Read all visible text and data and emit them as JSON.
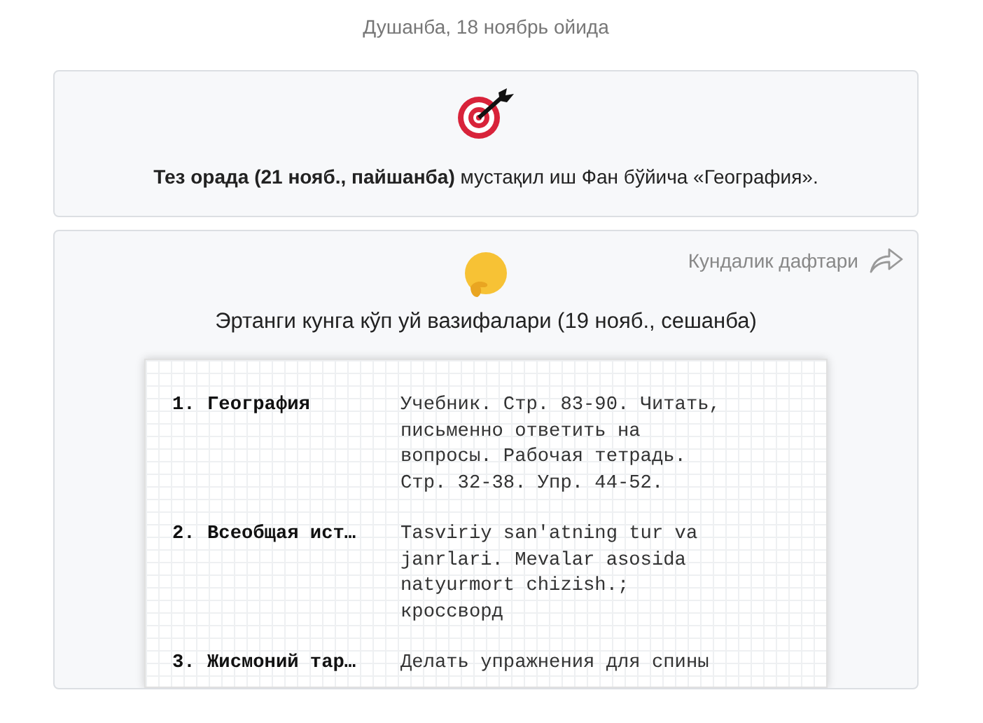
{
  "date_header": "Душанба, 18 ноябрь ойида",
  "deadline_card": {
    "text": "**Тез орада (21 нояб., пайшанба)** мустақил иш Фан бўйича «География»."
  },
  "homework_card": {
    "link": "Кундалик дафтари",
    "title": "Эртанги кунга кўп уй вазифалари (19 нояб., сешанба)",
    "items": [
      {
        "number": "1.",
        "subject": "География",
        "task": "Учебник. Стр. 83-90. Читать, письменно ответить на вопросы. Рабочая тетрадь. Стр. 32-38. Упр. 44-52."
      },
      {
        "number": "2.",
        "subject": "Всеобщая ист…",
        "task": "Tasviriy san'atning tur va janrlari. Mevalar asosida natyurmort chizish.; кроссворд"
      },
      {
        "number": "3.",
        "subject": "Жисмоний тар…",
        "task": "Делать упражнения для спины"
      }
    ]
  }
}
